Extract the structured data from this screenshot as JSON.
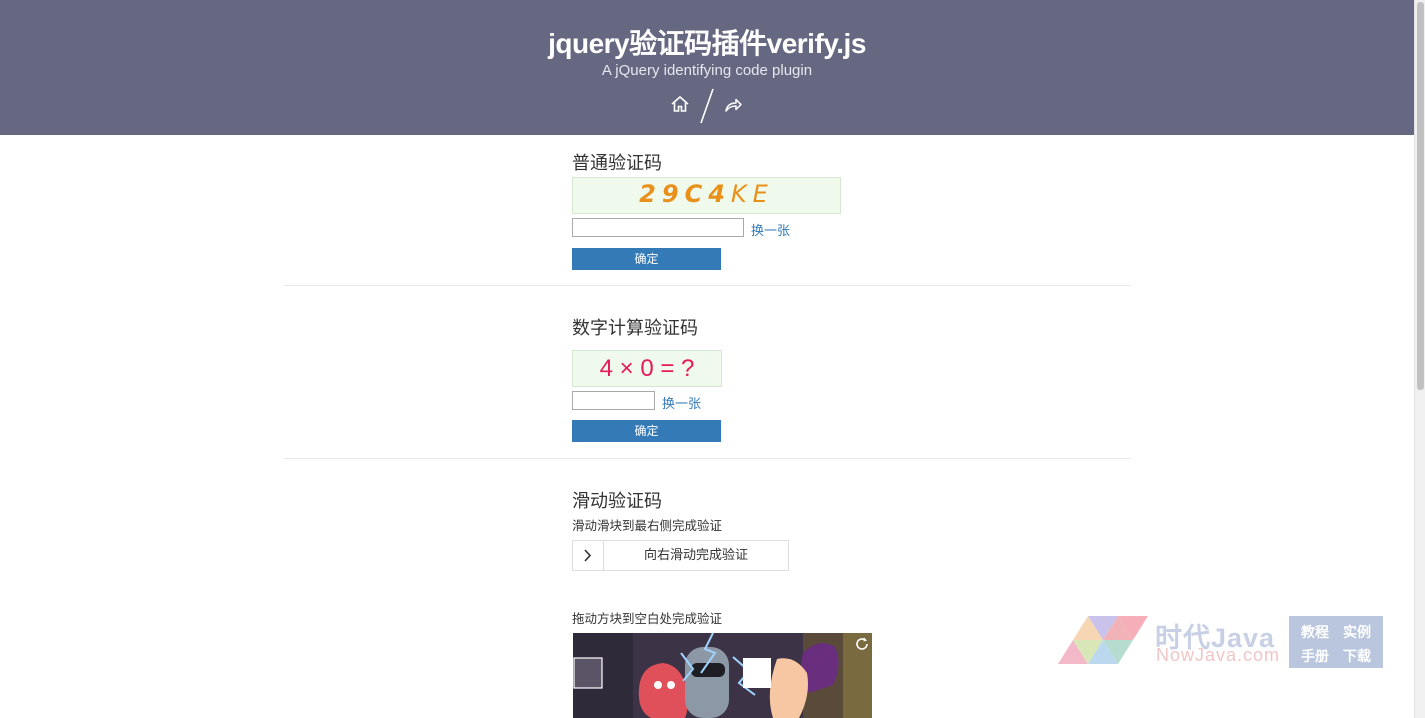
{
  "header": {
    "title": "jquery验证码插件verify.js",
    "subtitle": "A jQuery identifying code plugin",
    "icons": [
      "home-icon",
      "share-icon"
    ],
    "background": "#666882"
  },
  "normal": {
    "title": "普通验证码",
    "code_chars": [
      "2",
      "9",
      "C",
      "4",
      "K",
      "E"
    ],
    "code_colors": [
      "#e8911a",
      "#e8911a",
      "#e8911a",
      "#e8911a",
      "#e8911a",
      "#e8911a"
    ],
    "refresh_label": "换一张",
    "submit_label": "确定"
  },
  "calc": {
    "title": "数字计算验证码",
    "expression": "4 × 0 = ?",
    "expression_color": "#e6195a",
    "refresh_label": "换一张",
    "submit_label": "确定"
  },
  "slide": {
    "title": "滑动验证码",
    "hint": "滑动滑块到最右侧完成验证",
    "slider_label": "向右滑动完成验证",
    "handle_icon": "chevron-right-icon"
  },
  "drag": {
    "hint": "拖动方块到空白处完成验证",
    "refresh_icon": "refresh-icon"
  },
  "watermark": {
    "name": "时代Java",
    "domain": "NowJava.com",
    "links": [
      "教程",
      "实例",
      "手册",
      "下载"
    ]
  },
  "colors": {
    "accent": "#337ab7",
    "code_bg": "#eff9ec"
  }
}
